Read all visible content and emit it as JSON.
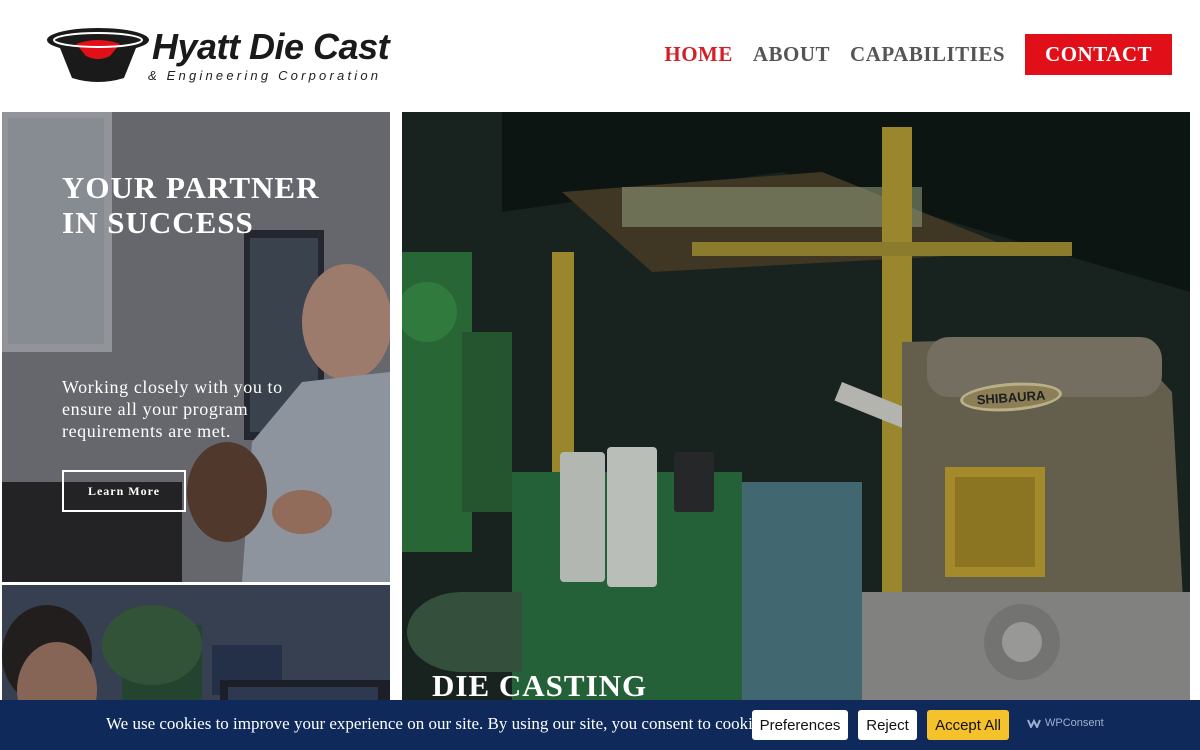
{
  "brand": {
    "name": "Hyatt Die Cast",
    "subtitle": "& Engineering Corporation",
    "accent_red": "#e10f17",
    "logo_icon": "bucket-logo-icon"
  },
  "nav": {
    "items": [
      {
        "label": "HOME",
        "active": true
      },
      {
        "label": "ABOUT",
        "active": false
      },
      {
        "label": "CAPABILITIES",
        "active": false
      },
      {
        "label": "CONTACT",
        "active": false
      }
    ]
  },
  "hero": {
    "title": "YOUR PARTNER\nIN SUCCESS",
    "text": "Working closely with you to ensure all your program requirements are met.",
    "button_label": "Learn More"
  },
  "feature": {
    "title": "DIE CASTING",
    "machine_plate": "SHIBAURA"
  },
  "cookie": {
    "message": "We use cookies to improve your experience on our site. By using our site, you consent to cookies.",
    "preferences_label": "Preferences",
    "reject_label": "Reject",
    "accept_label": "Accept All",
    "powered_by": "WPConsent",
    "bar_color": "#0f2a5a",
    "accept_color": "#f6c22b"
  }
}
